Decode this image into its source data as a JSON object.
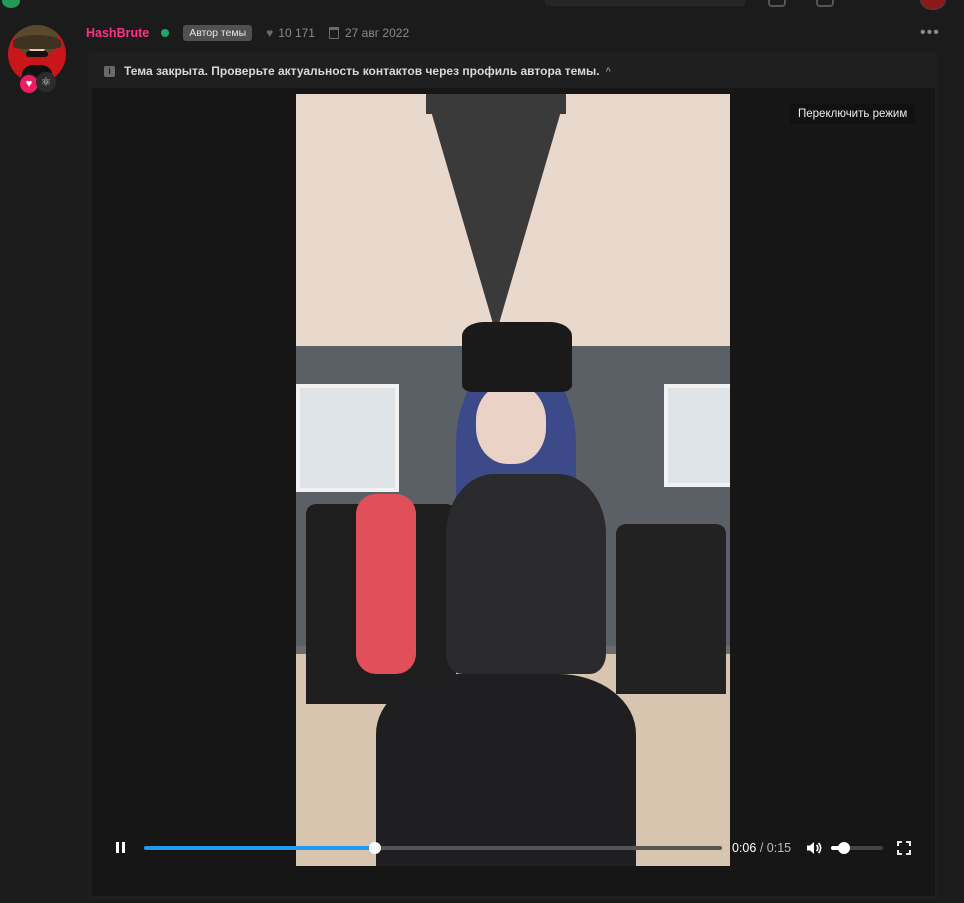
{
  "post": {
    "username": "HashBrute",
    "author_tag": "Автор темы",
    "likes": "10 171",
    "date": "27 авг 2022",
    "more": "•••"
  },
  "notice": {
    "text": "Тема закрыта. Проверьте актуальность контактов через профиль автора темы.",
    "info": "i",
    "chevron": "^"
  },
  "video": {
    "tooltip": "Переключить режим",
    "current_time": "0:06",
    "separator": " / ",
    "duration": "0:15",
    "progress_fraction": 0.4,
    "volume_fraction": 0.25
  },
  "badges": {
    "heart": "♥",
    "atom": "⚛"
  },
  "colors": {
    "username": "#ff2f8a",
    "online": "#1ea765",
    "progress": "#1e9cf0"
  },
  "icons": [
    "heart-icon",
    "calendar-icon",
    "info-icon",
    "pause-icon",
    "volume-icon",
    "fullscreen-icon",
    "more-icon"
  ]
}
